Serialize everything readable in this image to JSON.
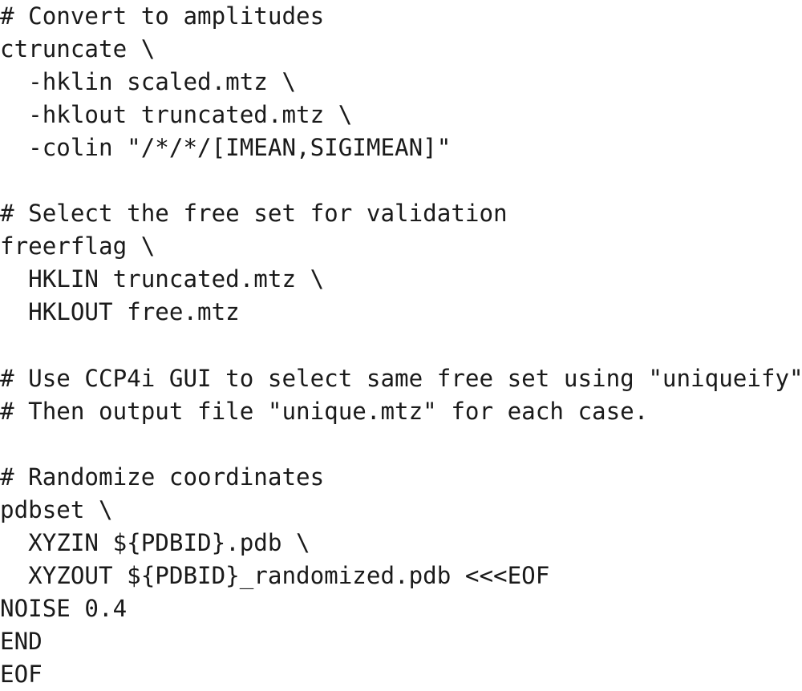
{
  "document": {
    "kind": "shell-script-listing",
    "background_color": "#ffffff",
    "text_color": "#1a1a1a",
    "font_style": "monospace-typewriter",
    "line_count": 21,
    "lines": [
      {
        "text": "# Convert to amplitudes",
        "kind": "comment"
      },
      {
        "text": "ctruncate \\",
        "kind": "command"
      },
      {
        "text": "  -hklin scaled.mtz \\",
        "kind": "argument"
      },
      {
        "text": "  -hklout truncated.mtz \\",
        "kind": "argument"
      },
      {
        "text": "  -colin \"/*/*/[IMEAN,SIGIMEAN]\"",
        "kind": "argument"
      },
      {
        "text": "",
        "kind": "blank"
      },
      {
        "text": "# Select the free set for validation",
        "kind": "comment"
      },
      {
        "text": "freerflag \\",
        "kind": "command"
      },
      {
        "text": "  HKLIN truncated.mtz \\",
        "kind": "argument"
      },
      {
        "text": "  HKLOUT free.mtz",
        "kind": "argument"
      },
      {
        "text": "",
        "kind": "blank"
      },
      {
        "text": "# Use CCP4i GUI to select same free set using \"uniqueify\"",
        "kind": "comment"
      },
      {
        "text": "# Then output file \"unique.mtz\" for each case.",
        "kind": "comment"
      },
      {
        "text": "",
        "kind": "blank"
      },
      {
        "text": "# Randomize coordinates",
        "kind": "comment"
      },
      {
        "text": "pdbset \\",
        "kind": "command"
      },
      {
        "text": "  XYZIN ${PDBID}.pdb \\",
        "kind": "argument"
      },
      {
        "text": "  XYZOUT ${PDBID}_randomized.pdb <<<EOF",
        "kind": "argument"
      },
      {
        "text": "NOISE 0.4",
        "kind": "keyword"
      },
      {
        "text": "END",
        "kind": "keyword"
      },
      {
        "text": "EOF",
        "kind": "keyword"
      }
    ]
  }
}
